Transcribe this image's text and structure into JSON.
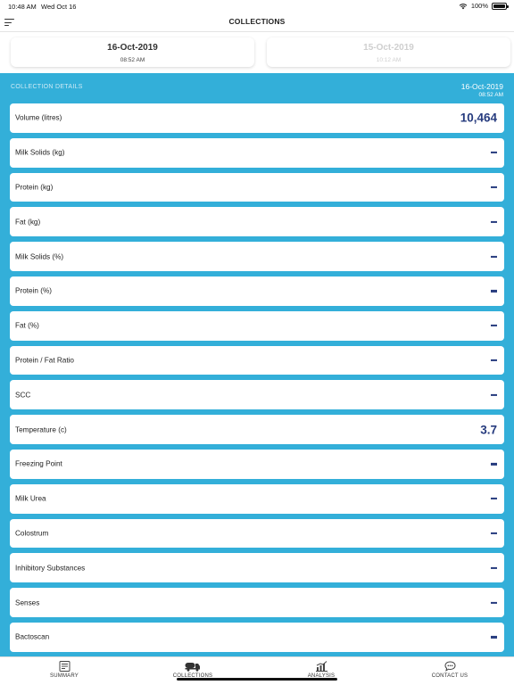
{
  "status_bar": {
    "time": "10:48 AM",
    "date": "Wed Oct 16",
    "battery": "100%"
  },
  "nav": {
    "title": "COLLECTIONS"
  },
  "date_tabs": [
    {
      "date": "16-Oct-2019",
      "time": "08:52 AM",
      "selected": true
    },
    {
      "date": "15-Oct-2019",
      "time": "10:12 AM",
      "selected": false
    }
  ],
  "details": {
    "header": "COLLECTION DETAILS",
    "date": "16-Oct-2019",
    "time": "08:52 AM",
    "rows": [
      {
        "label": "Volume (litres)",
        "value": "10,464"
      },
      {
        "label": "Milk Solids (kg)",
        "value": null
      },
      {
        "label": "Protein (kg)",
        "value": null
      },
      {
        "label": "Fat (kg)",
        "value": null
      },
      {
        "label": "Milk Solids (%)",
        "value": null
      },
      {
        "label": "Protein (%)",
        "value": null
      },
      {
        "label": "Fat (%)",
        "value": null
      },
      {
        "label": "Protein / Fat Ratio",
        "value": null
      },
      {
        "label": "SCC",
        "value": null
      },
      {
        "label": "Temperature (c)",
        "value": "3.7"
      },
      {
        "label": "Freezing Point",
        "value": null
      },
      {
        "label": "Milk Urea",
        "value": null
      },
      {
        "label": "Colostrum",
        "value": null
      },
      {
        "label": "Inhibitory Substances",
        "value": null
      },
      {
        "label": "Senses",
        "value": null
      },
      {
        "label": "Bactoscan",
        "value": null
      }
    ]
  },
  "tab_bar": {
    "tabs": [
      {
        "label": "SUMMARY",
        "icon": "summary-icon"
      },
      {
        "label": "COLLECTIONS",
        "icon": "truck-icon"
      },
      {
        "label": "ANALYSIS",
        "icon": "chart-icon"
      },
      {
        "label": "CONTACT US",
        "icon": "chat-icon"
      }
    ]
  },
  "colors": {
    "accent": "#33afd9",
    "value_text": "#263b7e"
  }
}
